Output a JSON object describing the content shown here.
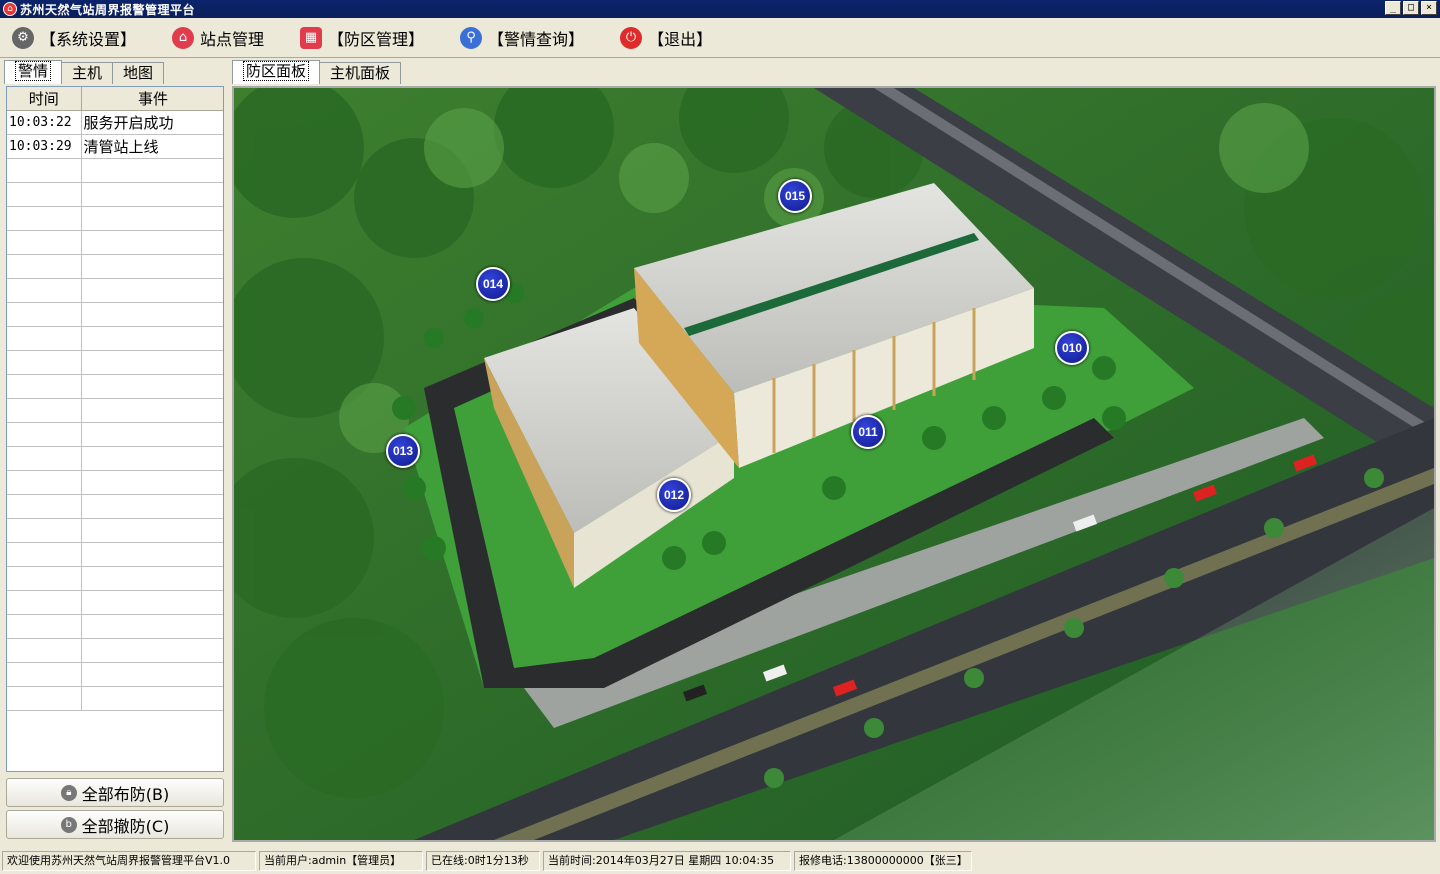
{
  "window": {
    "title": "苏州天然气站周界报警管理平台",
    "buttons": {
      "minimize": "_",
      "maximize": "□",
      "close": "×"
    }
  },
  "toolbar": {
    "items": [
      {
        "label": "【系统设置】",
        "icon": "gear-icon"
      },
      {
        "label": "站点管理",
        "icon": "home-icon"
      },
      {
        "label": "【防区管理】",
        "icon": "grid-icon"
      },
      {
        "label": "【警情查询】",
        "icon": "search-icon"
      },
      {
        "label": "【退出】",
        "icon": "power-icon"
      }
    ]
  },
  "left_panel": {
    "tabs": [
      "警情",
      "主机",
      "地图"
    ],
    "active_tab": "警情",
    "columns": [
      "时间",
      "事件"
    ],
    "rows": [
      {
        "time": "10:03:22",
        "event": "服务开启成功"
      },
      {
        "time": "10:03:29",
        "event": "清管站上线"
      }
    ],
    "arm_all_label": "全部布防(B)",
    "disarm_all_label": "全部撤防(C)"
  },
  "main_panel": {
    "tabs": [
      "防区面板",
      "主机面板"
    ],
    "active_tab": "防区面板",
    "zones": [
      "015",
      "014",
      "010",
      "011",
      "013",
      "012"
    ]
  },
  "status_bar": {
    "welcome": "欢迎使用苏州天然气站周界报警管理平台V1.0",
    "user": "当前用户:admin【管理员】",
    "online": "已在线:0时1分13秒",
    "time": "当前时间:2014年03月27日 星期四 10:04:35",
    "repair": "报修电话:13800000000【张三】"
  }
}
